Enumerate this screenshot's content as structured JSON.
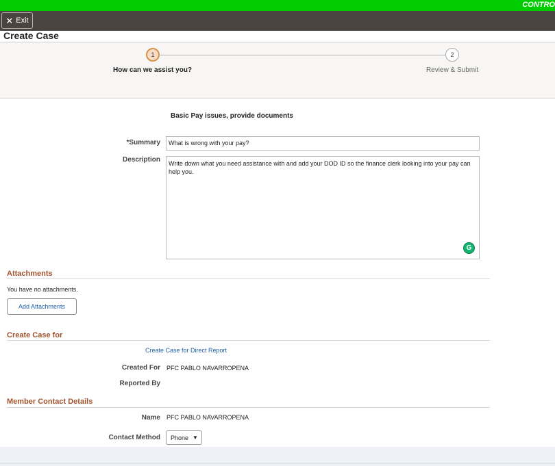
{
  "topbar": {
    "brand_text": "CONTRO",
    "color": "#00cc00"
  },
  "nav": {
    "exit_label": "Exit",
    "exit_icon": "close-icon"
  },
  "page": {
    "title": "Create Case"
  },
  "steps": [
    {
      "number": "1",
      "label": "How can we assist you?",
      "state": "active"
    },
    {
      "number": "2",
      "label": "Review & Submit",
      "state": "inactive"
    }
  ],
  "form": {
    "heading": "Basic Pay issues, provide documents",
    "summary_label": "*Summary",
    "summary_value": "What is wrong with your pay?",
    "description_label": "Description",
    "description_value": "Write down what you need assistance with and add your DOD ID so the finance clerk looking into your pay can help you.",
    "grammarly_icon": "grammarly-icon"
  },
  "attachments": {
    "title": "Attachments",
    "empty_text": "You have no attachments.",
    "add_button": "Add Attachments"
  },
  "create_for": {
    "title": "Create Case for",
    "direct_report_link": "Create Case for Direct Report",
    "created_for_label": "Created For",
    "created_for_value": "PFC PABLO NAVARROPENA",
    "reported_by_label": "Reported By"
  },
  "contact": {
    "title": "Member Contact Details",
    "name_label": "Name",
    "name_value": "PFC PABLO NAVARROPENA",
    "method_label": "Contact Method",
    "method_value": "Phone"
  },
  "colors": {
    "section_title": "#a0522d",
    "link": "#1f5fa8",
    "step_active": "#d9924a"
  }
}
